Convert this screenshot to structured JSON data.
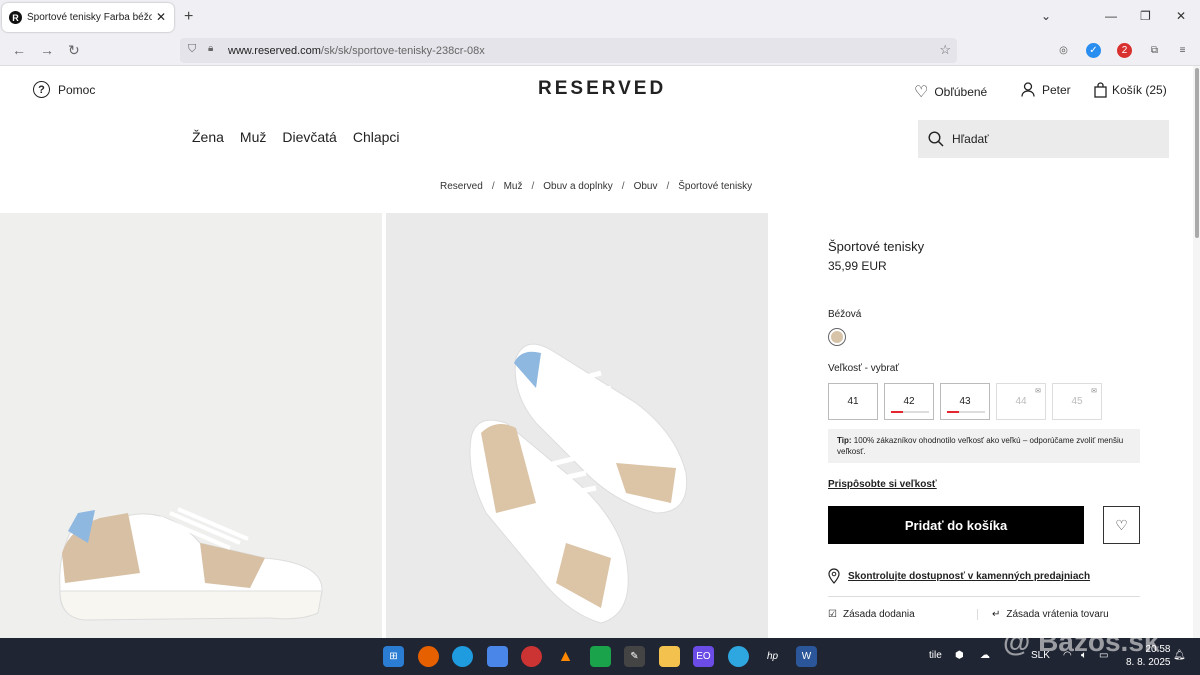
{
  "browser": {
    "tab_title": "Športové tenisky Farba béžová",
    "url_domain": "www.reserved.com",
    "url_path": "/sk/sk/sportove-tenisky-238cr-08x",
    "ext_badge": "2"
  },
  "header": {
    "help": "Pomoc",
    "logo": "RESERVED",
    "wishlist": "Obľúbené",
    "account": "Peter",
    "cart": "Košík (25)",
    "menu": [
      "Žena",
      "Muž",
      "Dievčatá",
      "Chlapci"
    ],
    "search_placeholder": "Hľadať"
  },
  "breadcrumb": [
    "Reserved",
    "Muž",
    "Obuv a doplnky",
    "Obuv",
    "Športové tenisky"
  ],
  "product": {
    "name": "Športové tenisky",
    "price": "35,99 EUR",
    "color_label": "Béžová",
    "color_hex": "#d7c3a8",
    "size_label": "Veľkosť -",
    "size_choose": "vybrať",
    "sizes": [
      {
        "label": "41",
        "available": true,
        "low_stock": false
      },
      {
        "label": "42",
        "available": true,
        "low_stock": true
      },
      {
        "label": "43",
        "available": true,
        "low_stock": true
      },
      {
        "label": "44",
        "available": false,
        "low_stock": false
      },
      {
        "label": "45",
        "available": false,
        "low_stock": false
      }
    ],
    "tip_label": "Tip:",
    "tip_text": "100% zákazníkov ohodnotilo veľkosť ako veľkú – odporúčame zvoliť menšiu veľkosť.",
    "fit_link": "Prispôsobte si veľkosť",
    "add_to_cart": "Pridať do košíka",
    "availability": "Skontrolujte dostupnosť v kamenných predajniach",
    "delivery": "Zásada dodania",
    "returns": "Zásada vrátenia tovaru"
  },
  "taskbar": {
    "lang": "SLK",
    "time": "20:58",
    "date": "8. 8. 2025",
    "watermark": "@ Bazos.sk"
  }
}
